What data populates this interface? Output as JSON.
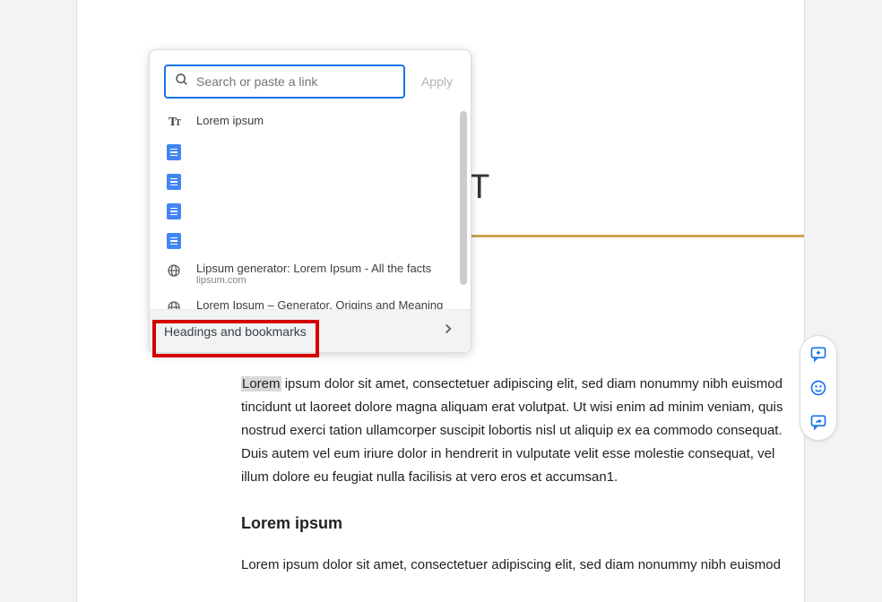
{
  "doc": {
    "title_visible_fragment": "AMET",
    "highlighted_word": "Lorem",
    "body1_rest": " ipsum dolor sit amet, consectetuer adipiscing elit, sed diam nonummy nibh euismod tincidunt ut laoreet dolore magna aliquam erat volutpat. Ut wisi enim ad minim veniam, quis nostrud exerci tation ullamcorper suscipit lobortis nisl ut aliquip ex ea commodo consequat. Duis autem vel eum iriure dolor in hendrerit in vulputate velit esse molestie consequat, vel illum dolore eu feugiat nulla facilisis at vero eros et accumsan1.",
    "subhead": "Lorem ipsum",
    "body2": "Lorem ipsum dolor sit amet, consectetuer adipiscing elit, sed diam nonummy nibh euismod"
  },
  "popup": {
    "search_placeholder": "Search or paste a link",
    "search_value": "",
    "apply_label": "Apply",
    "results": [
      {
        "kind": "text",
        "title": "Lorem ipsum",
        "sub": ""
      },
      {
        "kind": "doc",
        "title": "",
        "sub": ""
      },
      {
        "kind": "doc",
        "title": "",
        "sub": ""
      },
      {
        "kind": "doc",
        "title": "",
        "sub": ""
      },
      {
        "kind": "doc",
        "title": "",
        "sub": ""
      },
      {
        "kind": "web",
        "title": "Lipsum generator: Lorem Ipsum - All the facts",
        "sub": "lipsum.com"
      },
      {
        "kind": "web",
        "title": "Lorem Ipsum – Generator, Origins and Meaning",
        "sub": ""
      }
    ],
    "bottom_label": "Headings and bookmarks"
  },
  "side_tools": {
    "add_comment": "add-comment",
    "emoji": "emoji",
    "suggest": "suggest-edits"
  }
}
